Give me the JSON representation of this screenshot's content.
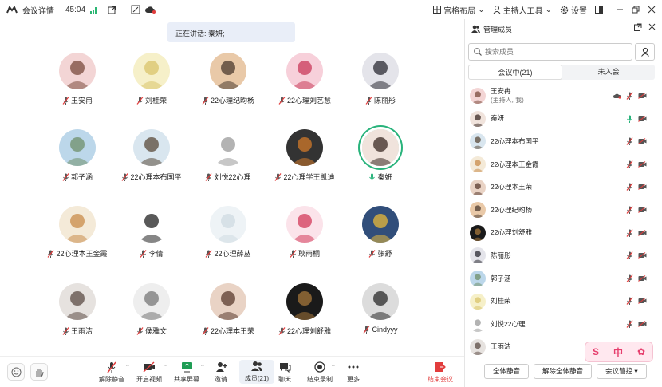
{
  "topbar": {
    "meeting_info": "会议详情",
    "timer": "45:04",
    "grid_layout": "宫格布局",
    "host_tools": "主持人工具",
    "settings": "设置"
  },
  "speaking": "正在讲话: 秦妍;",
  "tiles": [
    {
      "name": "王安冉",
      "mic": "muted"
    },
    {
      "name": "刘桂荣",
      "mic": "muted"
    },
    {
      "name": "22心理纪昀杨",
      "mic": "muted"
    },
    {
      "name": "22心理刘艺慧",
      "mic": "muted"
    },
    {
      "name": "陈丽彤",
      "mic": "muted"
    },
    {
      "name": "郭子涵",
      "mic": "muted"
    },
    {
      "name": "22心理本布国平",
      "mic": "muted"
    },
    {
      "name": "刘悦22心理",
      "mic": "muted"
    },
    {
      "name": "22心理学王凯迪",
      "mic": "muted"
    },
    {
      "name": "秦妍",
      "mic": "on"
    },
    {
      "name": "22心理本王金霞",
      "mic": "muted"
    },
    {
      "name": "李倩",
      "mic": "muted"
    },
    {
      "name": "22心理薛丛",
      "mic": "muted"
    },
    {
      "name": "耿雨桐",
      "mic": "muted"
    },
    {
      "name": "张舒",
      "mic": "muted"
    },
    {
      "name": "王雨洁",
      "mic": "muted"
    },
    {
      "name": "侯雅文",
      "mic": "muted"
    },
    {
      "name": "22心理本王荣",
      "mic": "muted"
    },
    {
      "name": "22心理刘舒雅",
      "mic": "muted"
    },
    {
      "name": "Cindyyy",
      "mic": "muted"
    }
  ],
  "toolbar": {
    "unmute": "解除静音",
    "start_video": "开启视频",
    "share_screen": "共享屏幕",
    "invite": "邀请",
    "members": "成员(21)",
    "chat": "聊天",
    "end_recording": "结束录制",
    "more": "更多",
    "end_meeting": "结束会议"
  },
  "panel": {
    "title": "管理成员",
    "search_placeholder": "搜索成员",
    "tab_in_meeting": "会议中(21)",
    "tab_not_joined": "未入会",
    "members": [
      {
        "name": "王安冉",
        "sub": "(主持人, 我)",
        "mic": "muted"
      },
      {
        "name": "秦妍",
        "sub": "",
        "mic": "on"
      },
      {
        "name": "22心理本布国平",
        "sub": "",
        "mic": "muted"
      },
      {
        "name": "22心理本王金霞",
        "sub": "",
        "mic": "muted"
      },
      {
        "name": "22心理本王荣",
        "sub": "",
        "mic": "muted"
      },
      {
        "name": "22心理纪昀杨",
        "sub": "",
        "mic": "muted"
      },
      {
        "name": "22心理刘舒雅",
        "sub": "",
        "mic": "muted"
      },
      {
        "name": "陈丽彤",
        "sub": "",
        "mic": "muted"
      },
      {
        "name": "郭子涵",
        "sub": "",
        "mic": "muted"
      },
      {
        "name": "刘桂荣",
        "sub": "",
        "mic": "muted"
      },
      {
        "name": "刘悦22心理",
        "sub": "",
        "mic": "muted"
      },
      {
        "name": "王雨洁",
        "sub": "",
        "mic": "muted"
      }
    ],
    "mute_all": "全体静音",
    "unmute_all": "解除全体静音",
    "meeting_control": "会议管控 ▾"
  },
  "watermark": {
    "c1": "S",
    "c2": "中",
    "c3": "✿"
  },
  "colors": {
    "accent_green": "#28b37b",
    "muted_red": "#e23d3d",
    "end_red": "#e23d3d"
  }
}
